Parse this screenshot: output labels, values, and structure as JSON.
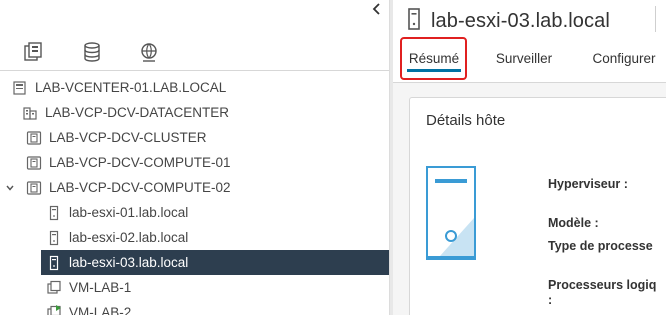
{
  "navigator": {
    "collapse_icon": "chevron-left-icon",
    "tabs": [
      {
        "name": "hosts-clusters",
        "icon": "hosts-clusters-icon"
      },
      {
        "name": "storage",
        "icon": "datastore-icon"
      },
      {
        "name": "networking",
        "icon": "network-icon"
      }
    ],
    "tree": [
      {
        "label": "LAB-VCENTER-01.LAB.LOCAL",
        "icon": "vcenter-icon",
        "level": 0
      },
      {
        "label": "LAB-VCP-DCV-DATACENTER",
        "icon": "datacenter-icon",
        "level": 1
      },
      {
        "label": "LAB-VCP-DCV-CLUSTER",
        "icon": "cluster-icon",
        "level": 2
      },
      {
        "label": "LAB-VCP-DCV-COMPUTE-01",
        "icon": "cluster-icon",
        "level": 2
      },
      {
        "label": "LAB-VCP-DCV-COMPUTE-02",
        "icon": "cluster-icon",
        "level": 2,
        "expanded": true
      },
      {
        "label": "lab-esxi-01.lab.local",
        "icon": "host-icon",
        "level": 3
      },
      {
        "label": "lab-esxi-02.lab.local",
        "icon": "host-icon",
        "level": 3
      },
      {
        "label": "lab-esxi-03.lab.local",
        "icon": "host-icon",
        "level": 3,
        "selected": true
      },
      {
        "label": "VM-LAB-1",
        "icon": "vm-icon",
        "level": 3
      },
      {
        "label": "VM-LAB-2",
        "icon": "vm-powered-on-icon",
        "level": 3
      }
    ]
  },
  "header": {
    "title": "lab-esxi-03.lab.local",
    "icon": "host-icon"
  },
  "tabs": [
    {
      "label": "Résumé",
      "active": true
    },
    {
      "label": "Surveiller"
    },
    {
      "label": "Configurer"
    }
  ],
  "details": {
    "title": "Détails hôte",
    "graphic_icon": "server-tower-icon",
    "labels": {
      "hypervisor": "Hyperviseur :",
      "model": "Modèle :",
      "processor_type": "Type de processe",
      "logical_processors": "Processeurs logiq",
      "logical_processors_colon": ":"
    }
  },
  "colors": {
    "selected_bg": "#2d3e4f",
    "accent": "#0072a3",
    "highlight_box": "#e02020",
    "graphic_blue": "#3a9bd5"
  }
}
